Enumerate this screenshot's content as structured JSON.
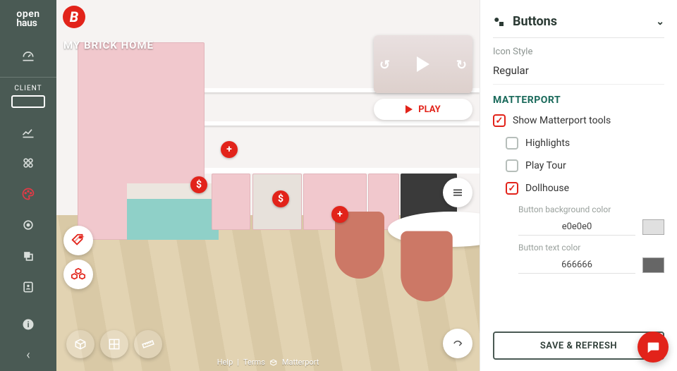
{
  "app": {
    "logo1": "open",
    "logo2": "haus"
  },
  "sidebar": {
    "client_label": "CLIENT"
  },
  "viewer": {
    "project_title": "MY BRICK HOME",
    "brand_letter": "B",
    "play_label": "PLAY",
    "footer": {
      "help": "Help",
      "terms": "Terms",
      "provider": "Matterport"
    }
  },
  "panel": {
    "section_title": "Buttons",
    "icon_style_label": "Icon Style",
    "icon_style_value": "Regular",
    "matterport_heading": "MATTERPORT",
    "checks": {
      "show_tools": "Show Matterport tools",
      "highlights": "Highlights",
      "play_tour": "Play Tour",
      "dollhouse": "Dollhouse"
    },
    "bg_color_label": "Button background color",
    "bg_color_value": "e0e0e0",
    "text_color_label": "Button text color",
    "text_color_value": "666666",
    "save_label": "SAVE & REFRESH"
  }
}
